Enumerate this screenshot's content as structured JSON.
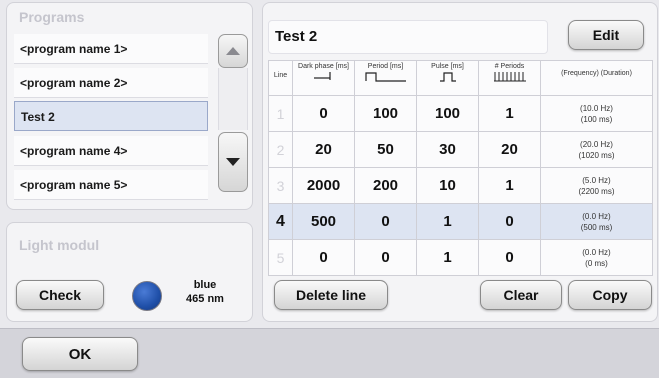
{
  "programs": {
    "title": "Programs",
    "items": [
      {
        "label": "<program name 1>",
        "selected": false
      },
      {
        "label": "<program name 2>",
        "selected": false
      },
      {
        "label": "Test 2",
        "selected": true
      },
      {
        "label": "<program name 4>",
        "selected": false
      },
      {
        "label": "<program name 5>",
        "selected": false
      }
    ]
  },
  "light": {
    "title": "Light modul",
    "check_label": "Check",
    "color_name": "blue",
    "wavelength": "465 nm",
    "led_color": "#1f4fa8"
  },
  "editor": {
    "program_name": "Test 2",
    "edit_label": "Edit",
    "columns": {
      "line": "Line",
      "dark": "Dark phase [ms]",
      "period": "Period [ms]",
      "pulse": "Pulse [ms]",
      "periods": "# Periods",
      "freq": "(Frequency) (Duration)"
    },
    "rows": [
      {
        "line": "1",
        "dark": "0",
        "period": "100",
        "pulse": "100",
        "periods": "1",
        "freq": "(10.0 Hz)",
        "duration": "(100 ms)"
      },
      {
        "line": "2",
        "dark": "20",
        "period": "50",
        "pulse": "30",
        "periods": "20",
        "freq": "(20.0 Hz)",
        "duration": "(1020 ms)"
      },
      {
        "line": "3",
        "dark": "2000",
        "period": "200",
        "pulse": "10",
        "periods": "1",
        "freq": "(5.0 Hz)",
        "duration": "(2200 ms)"
      },
      {
        "line": "4",
        "dark": "500",
        "period": "0",
        "pulse": "1",
        "periods": "0",
        "freq": "(0.0 Hz)",
        "duration": "(500 ms)"
      },
      {
        "line": "5",
        "dark": "0",
        "period": "0",
        "pulse": "1",
        "periods": "0",
        "freq": "(0.0 Hz)",
        "duration": "(0 ms)"
      }
    ],
    "selected_row": 3,
    "delete_label": "Delete line",
    "clear_label": "Clear",
    "copy_label": "Copy"
  },
  "footer": {
    "ok_label": "OK"
  }
}
